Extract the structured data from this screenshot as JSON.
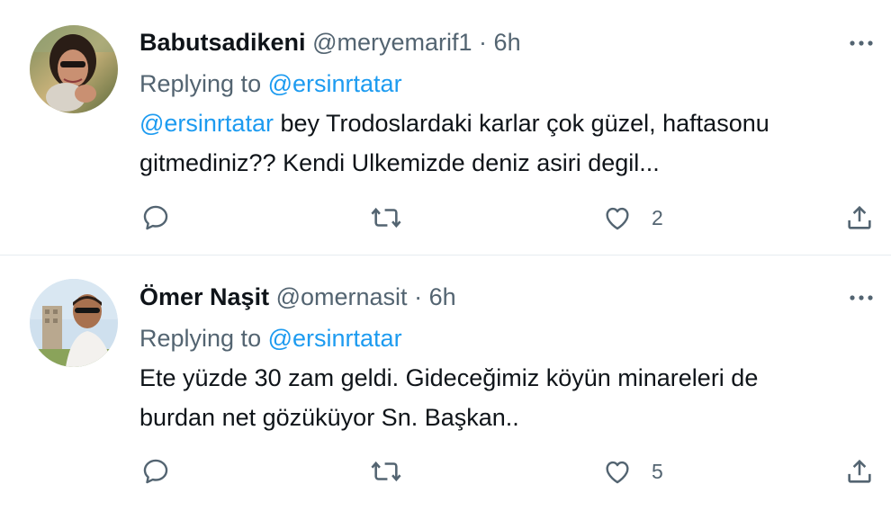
{
  "tweets": [
    {
      "display_name": "Babutsadikeni",
      "handle": "@meryemarif1",
      "separator": "·",
      "time": "6h",
      "replying_prefix": "Replying to",
      "replying_to": "@ersinrtatar",
      "body_mention": "@ersinrtatar",
      "body_line1_rest": " bey Trodoslardaki karlar çok güzel, haftasonu",
      "body_line2": "gitmediniz?? Kendi Ulkemizde deniz asiri degil...",
      "like_count": "2",
      "icons": [
        "more-icon",
        "reply-icon",
        "retweet-icon",
        "like-icon",
        "share-icon"
      ]
    },
    {
      "display_name": "Ömer Naşit",
      "handle": "@omernasit",
      "separator": "·",
      "time": "6h",
      "replying_prefix": "Replying to",
      "replying_to": "@ersinrtatar",
      "body_line1": "Ete yüzde 30 zam geldi. Gideceğimiz köyün minareleri de",
      "body_line2": "burdan net gözüküyor Sn. Başkan..",
      "like_count": "5",
      "icons": [
        "more-icon",
        "reply-icon",
        "retweet-icon",
        "like-icon",
        "share-icon"
      ]
    }
  ],
  "colors": {
    "text": "#0f1419",
    "secondary": "#536471",
    "link": "#1d9bf0",
    "divider": "#e6ecf0"
  }
}
